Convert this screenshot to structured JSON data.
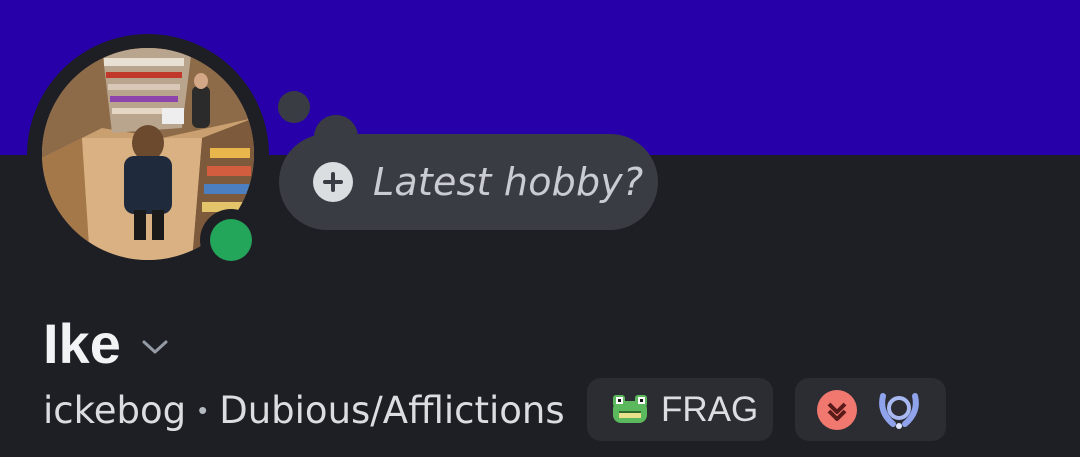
{
  "profile": {
    "display_name": "Ike",
    "username": "ickebog",
    "separator": "•",
    "pronouns_or_server": "Dubious/Afflictions",
    "status": "online"
  },
  "status_bubble": {
    "placeholder": "Latest hobby?"
  },
  "guild_tag": {
    "text": "FRAG",
    "icon": "frog-icon"
  },
  "badges": [
    {
      "name": "chevron-badge-icon"
    },
    {
      "name": "laurel-badge-icon"
    }
  ],
  "colors": {
    "banner": "#2800aa",
    "background": "#1e1f24",
    "online": "#23a55a",
    "bubble": "#3a3c43",
    "pill": "#2c2d33"
  }
}
